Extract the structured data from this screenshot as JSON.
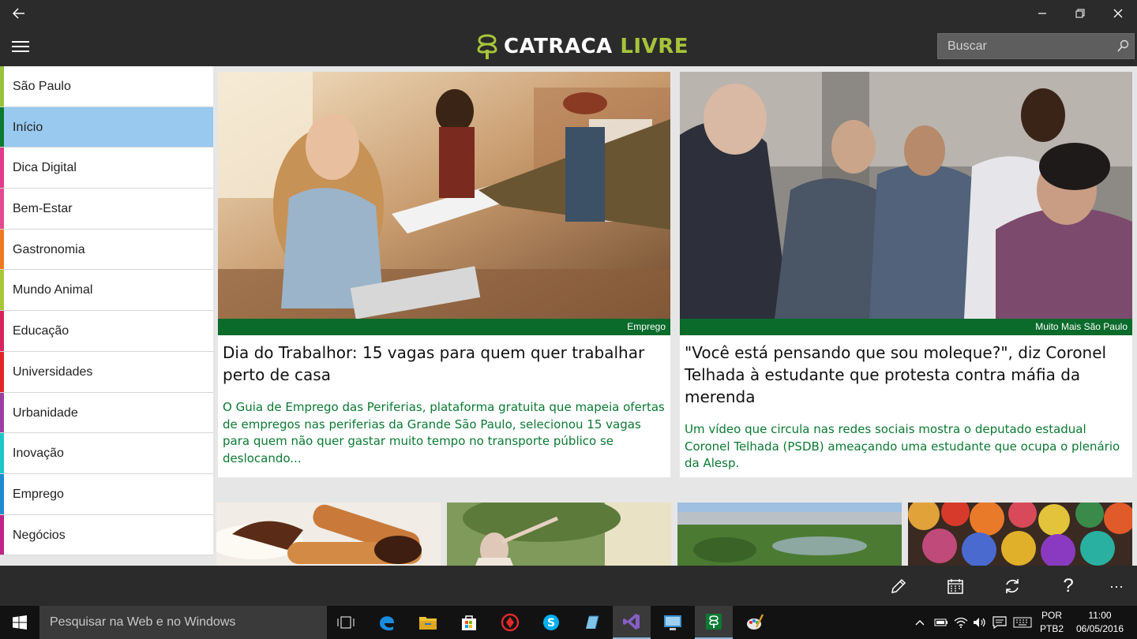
{
  "app": {
    "logo_word1": "CATRACA",
    "logo_word2": "LIVRE"
  },
  "search": {
    "placeholder": "Buscar"
  },
  "sidebar": {
    "items": [
      {
        "label": "São Paulo",
        "color": "#9ac23c",
        "active": false
      },
      {
        "label": "Início",
        "color": "#0a7a32",
        "active": true
      },
      {
        "label": "Dica Digital",
        "color": "#e23a8c",
        "active": false
      },
      {
        "label": "Bem-Estar",
        "color": "#e44a8f",
        "active": false
      },
      {
        "label": "Gastronomia",
        "color": "#f07a22",
        "active": false
      },
      {
        "label": "Mundo Animal",
        "color": "#a8c63a",
        "active": false
      },
      {
        "label": "Educação",
        "color": "#d9235f",
        "active": false
      },
      {
        "label": "Universidades",
        "color": "#e42328",
        "active": false
      },
      {
        "label": "Urbanidade",
        "color": "#9b3ea3",
        "active": false
      },
      {
        "label": "Inovação",
        "color": "#1ec6c8",
        "active": false
      },
      {
        "label": "Emprego",
        "color": "#1e8bd0",
        "active": false
      },
      {
        "label": "Negócios",
        "color": "#c02289",
        "active": false
      }
    ]
  },
  "articles": [
    {
      "category": "Emprego",
      "title": "Dia do Trabalhor: 15 vagas para quem quer trabalhar perto de casa",
      "summary": "O Guia de Emprego das Periferias, plataforma gratuita que mapeia ofertas de empregos nas periferias da Grande São Paulo, selecionou 15 vagas para quem não quer gastar muito tempo no transporte público se deslocando..."
    },
    {
      "category": "Muito Mais São Paulo",
      "title": "\"Você está pensando que sou moleque?\", diz Coronel Telhada à estudante que protesta contra máfia da merenda",
      "summary": "Um vídeo que circula nas redes sociais mostra o deputado estadual Coronel Telhada (PSDB) ameaçando uma estudante que ocupa o plenário da Alesp."
    }
  ],
  "appbar": {
    "icons": [
      "edit-icon",
      "calendar-icon",
      "refresh-icon",
      "help-icon",
      "more-icon"
    ],
    "help_glyph": "?",
    "more_glyph": "···"
  },
  "taskbar": {
    "search_placeholder": "Pesquisar na Web e no Windows",
    "apps": [
      "task-view-icon",
      "edge-icon",
      "file-explorer-icon",
      "store-icon",
      "app-red-icon",
      "skype-icon",
      "app-blue-icon",
      "visual-studio-icon",
      "remote-desktop-icon",
      "catraca-livre-icon",
      "paint-icon"
    ],
    "lang_line1": "POR",
    "lang_line2": "PTB2",
    "time": "11:00",
    "date": "06/05/2016"
  }
}
